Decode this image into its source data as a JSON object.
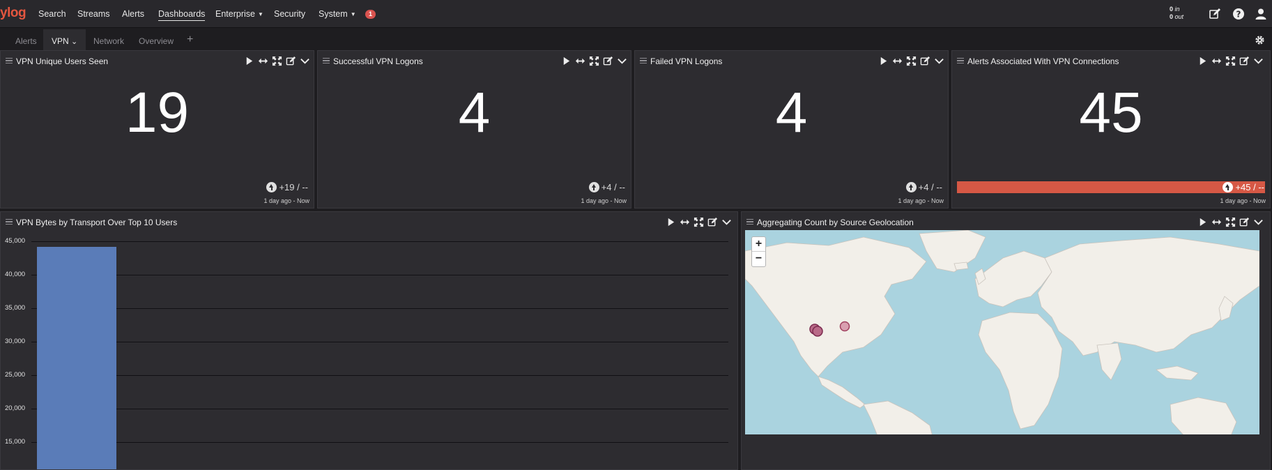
{
  "nav": {
    "logo": "ylog",
    "items": [
      {
        "label": "Search"
      },
      {
        "label": "Streams"
      },
      {
        "label": "Alerts"
      },
      {
        "label": "Dashboards"
      },
      {
        "label": "Enterprise"
      },
      {
        "label": "Security"
      },
      {
        "label": "System"
      }
    ],
    "notification_count": "1",
    "throughput_in": "0",
    "throughput_in_label": "in",
    "throughput_out": "0",
    "throughput_out_label": "out",
    "icons": [
      "edit-icon",
      "help-icon",
      "user-icon"
    ]
  },
  "tabs": [
    {
      "label": "Alerts"
    },
    {
      "label": "VPN"
    },
    {
      "label": "Network"
    },
    {
      "label": "Overview"
    }
  ],
  "add_tab_label": "+",
  "widgets": {
    "unique_users": {
      "title": "VPN Unique Users Seen",
      "value": "19",
      "trend": "+19 / --",
      "period": "1 day ago - Now"
    },
    "successful_logons": {
      "title": "Successful VPN Logons",
      "value": "4",
      "trend": "+4 / --",
      "period": "1 day ago - Now"
    },
    "failed_logons": {
      "title": "Failed VPN Logons",
      "value": "4",
      "trend": "+4 / --",
      "period": "1 day ago - Now"
    },
    "alerts_vpn": {
      "title": "Alerts Associated With VPN Connections",
      "value": "45",
      "trend": "+45 / --",
      "period": "1 day ago - Now",
      "trend_color": "#d65845"
    },
    "bytes_chart": {
      "title": "VPN Bytes by Transport Over Top 10 Users"
    },
    "geo_map": {
      "title": "Aggregating Count by Source Geolocation",
      "zoom_in": "+",
      "zoom_out": "−"
    }
  },
  "chart_data": {
    "type": "bar",
    "yticks": [
      "45,000",
      "40,000",
      "35,000",
      "30,000",
      "25,000",
      "20,000",
      "15,000"
    ],
    "ytick_values": [
      45000,
      40000,
      35000,
      30000,
      25000,
      20000,
      15000
    ],
    "values": [
      44200
    ],
    "ylim": [
      12000,
      45000
    ],
    "grid": true,
    "bar_color": "#5a7cb8"
  }
}
